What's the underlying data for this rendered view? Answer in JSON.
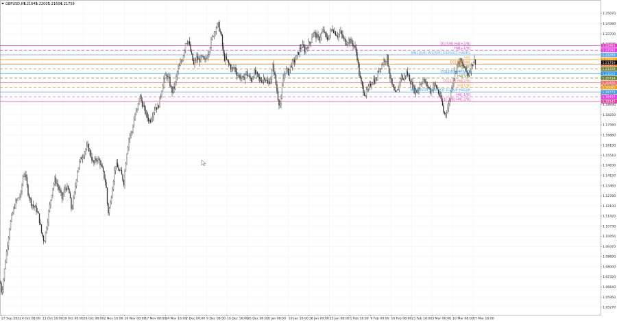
{
  "window": {
    "symbol_title": "GBPUSD,H4",
    "ohlc": [
      "1.21649",
      "1.22005",
      "1.21604",
      "1.21759"
    ]
  },
  "colors": {
    "background": "#ffffff",
    "candle": "#2f2f2f",
    "grid": "#eeeeee"
  },
  "chart_data": {
    "type": "line",
    "ylim": [
      1.0476,
      1.2593
    ],
    "yticks": [
      "1.25070",
      "1.24380",
      "1.23700",
      "1.23020",
      "1.22340",
      "1.21660",
      "1.20970",
      "1.20290",
      "1.19610",
      "1.18930",
      "1.18250",
      "1.17560",
      "1.16880",
      "1.16190",
      "1.15510",
      "1.14830",
      "1.14150",
      "1.13460",
      "1.12780",
      "1.12100",
      "1.11420",
      "1.10730",
      "1.10050",
      "1.09370",
      "1.08690",
      "1.08000",
      "1.07320",
      "1.06640",
      "1.05950",
      "1.05270"
    ],
    "xticks": [
      "27 Sep 2022",
      "4 Oct 08:00",
      "11 Oct 16:00",
      "19 Oct 00:00",
      "26 Oct 08:00",
      "2 Nov 16:00",
      "10 Nov 00:00",
      "17 Nov 08:00",
      "24 Nov 16:00",
      "2 Dec 00:00",
      "9 Dec 08:00",
      "16 Dec 16:00",
      "26 Dec 00:00",
      "3 Jan 08:00",
      "10 Jan 16:00",
      "18 Jan 00:00",
      "25 Jan 08:00",
      "1 Feb 16:00",
      "9 Feb 00:00",
      "16 Feb 08:00",
      "23 Feb 16:00",
      "3 Mar 00:00",
      "10 Mar 08:00",
      "17 Mar 16:00"
    ],
    "price_path": [
      [
        0,
        1.069
      ],
      [
        2,
        1.062
      ],
      [
        6,
        1.078
      ],
      [
        10,
        1.094
      ],
      [
        14,
        1.108
      ],
      [
        18,
        1.116
      ],
      [
        22,
        1.123
      ],
      [
        26,
        1.126
      ],
      [
        30,
        1.129
      ],
      [
        33,
        1.141
      ],
      [
        36,
        1.143
      ],
      [
        40,
        1.131
      ],
      [
        44,
        1.124
      ],
      [
        48,
        1.121
      ],
      [
        52,
        1.119
      ],
      [
        56,
        1.114
      ],
      [
        60,
        1.103
      ],
      [
        64,
        1.097
      ],
      [
        68,
        1.109
      ],
      [
        72,
        1.121
      ],
      [
        76,
        1.133
      ],
      [
        80,
        1.139
      ],
      [
        85,
        1.133
      ],
      [
        90,
        1.126
      ],
      [
        95,
        1.134
      ],
      [
        100,
        1.131
      ],
      [
        104,
        1.118
      ],
      [
        108,
        1.129
      ],
      [
        112,
        1.144
      ],
      [
        116,
        1.151
      ],
      [
        120,
        1.155
      ],
      [
        124,
        1.159
      ],
      [
        128,
        1.161
      ],
      [
        132,
        1.155
      ],
      [
        136,
        1.149
      ],
      [
        140,
        1.153
      ],
      [
        145,
        1.151
      ],
      [
        150,
        1.143
      ],
      [
        154,
        1.136
      ],
      [
        157,
        1.116
      ],
      [
        160,
        1.121
      ],
      [
        164,
        1.136
      ],
      [
        168,
        1.149
      ],
      [
        172,
        1.146
      ],
      [
        176,
        1.143
      ],
      [
        180,
        1.137
      ],
      [
        184,
        1.156
      ],
      [
        188,
        1.168
      ],
      [
        192,
        1.171
      ],
      [
        196,
        1.182
      ],
      [
        200,
        1.186
      ],
      [
        203,
        1.196
      ],
      [
        206,
        1.191
      ],
      [
        210,
        1.186
      ],
      [
        214,
        1.181
      ],
      [
        218,
        1.178
      ],
      [
        222,
        1.183
      ],
      [
        226,
        1.188
      ],
      [
        230,
        1.187
      ],
      [
        234,
        1.196
      ],
      [
        238,
        1.206
      ],
      [
        242,
        1.209
      ],
      [
        246,
        1.206
      ],
      [
        250,
        1.198
      ],
      [
        254,
        1.201
      ],
      [
        258,
        1.211
      ],
      [
        262,
        1.216
      ],
      [
        266,
        1.221
      ],
      [
        270,
        1.231
      ],
      [
        274,
        1.233
      ],
      [
        278,
        1.224
      ],
      [
        282,
        1.216
      ],
      [
        286,
        1.221
      ],
      [
        290,
        1.219
      ],
      [
        294,
        1.221
      ],
      [
        298,
        1.218
      ],
      [
        302,
        1.223
      ],
      [
        306,
        1.229
      ],
      [
        310,
        1.236
      ],
      [
        314,
        1.241
      ],
      [
        318,
        1.243
      ],
      [
        322,
        1.236
      ],
      [
        326,
        1.221
      ],
      [
        330,
        1.219
      ],
      [
        334,
        1.216
      ],
      [
        338,
        1.213
      ],
      [
        342,
        1.214
      ],
      [
        346,
        1.209
      ],
      [
        350,
        1.208
      ],
      [
        354,
        1.206
      ],
      [
        358,
        1.211
      ],
      [
        362,
        1.208
      ],
      [
        366,
        1.206
      ],
      [
        370,
        1.211
      ],
      [
        374,
        1.209
      ],
      [
        378,
        1.206
      ],
      [
        382,
        1.206
      ],
      [
        386,
        1.208
      ],
      [
        390,
        1.203
      ],
      [
        394,
        1.206
      ],
      [
        398,
        1.216
      ],
      [
        402,
        1.203
      ],
      [
        406,
        1.191
      ],
      [
        409,
        1.189
      ],
      [
        412,
        1.206
      ],
      [
        416,
        1.213
      ],
      [
        420,
        1.211
      ],
      [
        424,
        1.216
      ],
      [
        428,
        1.218
      ],
      [
        432,
        1.221
      ],
      [
        436,
        1.226
      ],
      [
        440,
        1.229
      ],
      [
        444,
        1.226
      ],
      [
        448,
        1.229
      ],
      [
        452,
        1.231
      ],
      [
        456,
        1.238
      ],
      [
        460,
        1.236
      ],
      [
        464,
        1.233
      ],
      [
        468,
        1.237
      ],
      [
        472,
        1.239
      ],
      [
        476,
        1.233
      ],
      [
        480,
        1.236
      ],
      [
        484,
        1.241
      ],
      [
        488,
        1.238
      ],
      [
        492,
        1.236
      ],
      [
        496,
        1.238
      ],
      [
        500,
        1.234
      ],
      [
        504,
        1.231
      ],
      [
        508,
        1.233
      ],
      [
        512,
        1.231
      ],
      [
        516,
        1.229
      ],
      [
        520,
        1.223
      ],
      [
        524,
        1.208
      ],
      [
        528,
        1.201
      ],
      [
        532,
        1.196
      ],
      [
        536,
        1.199
      ],
      [
        540,
        1.203
      ],
      [
        544,
        1.206
      ],
      [
        548,
        1.205
      ],
      [
        552,
        1.213
      ],
      [
        556,
        1.216
      ],
      [
        560,
        1.219
      ],
      [
        564,
        1.221
      ],
      [
        568,
        1.209
      ],
      [
        572,
        1.201
      ],
      [
        576,
        1.196
      ],
      [
        580,
        1.199
      ],
      [
        584,
        1.209
      ],
      [
        588,
        1.206
      ],
      [
        592,
        1.211
      ],
      [
        596,
        1.208
      ],
      [
        600,
        1.203
      ],
      [
        604,
        1.199
      ],
      [
        608,
        1.198
      ],
      [
        612,
        1.203
      ],
      [
        616,
        1.206
      ],
      [
        620,
        1.204
      ],
      [
        624,
        1.201
      ],
      [
        628,
        1.198
      ],
      [
        632,
        1.203
      ],
      [
        636,
        1.201
      ],
      [
        640,
        1.196
      ],
      [
        644,
        1.191
      ],
      [
        647,
        1.183
      ],
      [
        650,
        1.184
      ],
      [
        654,
        1.189
      ],
      [
        658,
        1.201
      ],
      [
        662,
        1.209
      ],
      [
        666,
        1.216
      ],
      [
        670,
        1.219
      ],
      [
        674,
        1.216
      ],
      [
        678,
        1.213
      ],
      [
        682,
        1.209
      ],
      [
        686,
        1.214
      ],
      [
        690,
        1.219
      ],
      [
        693,
        1.218
      ]
    ],
    "levels": [
      {
        "price": 1.22901,
        "label": "D1[5/8] H4[+2/8]",
        "color": "#e040c0",
        "style": "solid",
        "tag": "1.22901"
      },
      {
        "price": 1.22592,
        "label": "H4[+1/8]",
        "color": "#e040e0",
        "style": "dash",
        "tag": "1.22592"
      },
      {
        "price": 1.2228,
        "label": "MN1[5/8] W1[5/8] D1PIVOT H4RES",
        "color": "#5fa8e8",
        "style": "solid",
        "tag": "1.22280"
      },
      {
        "price": 1.21962,
        "label": "H4[",
        "color": "#f0a020",
        "style": "solid",
        "tag": "1.21962"
      },
      {
        "price": 1.2165,
        "label": "D1[3/8] H4[",
        "color": "#f07020",
        "style": "solid",
        "tag": "1.21650"
      },
      {
        "price": 1.21339,
        "label": "H4[5/8]",
        "color": "#708030",
        "style": "dash",
        "tag": "1.21339"
      },
      {
        "price": 1.21025,
        "label": "D1[2/8] H4PIVOT",
        "color": "#3090e0",
        "style": "solid",
        "tag": "1.21025"
      },
      {
        "price": 1.20714,
        "label": "H4[3/8]",
        "color": "#708030",
        "style": "dash",
        "tag": "1.20714"
      },
      {
        "price": 1.204,
        "label": "D1[1/8] H4[2/8]",
        "color": "#f07070",
        "style": "solid",
        "tag": "1.20400"
      },
      {
        "price": 1.20085,
        "label": "H4[1/8]",
        "color": "#f0a020",
        "style": "dash",
        "tag": "1.20085"
      },
      {
        "price": 1.19773,
        "label": "MN1PIVOT W1PIVOT D1SUP H4SUP",
        "color": "#40a0e0",
        "style": "solid",
        "tag": "1.19773"
      },
      {
        "price": 1.19457,
        "label": "H4[-1/8]",
        "color": "#e040e0",
        "style": "dash",
        "tag": "1.19457"
      },
      {
        "price": 1.19147,
        "label": "D1[-1/8] H4[-2/8]",
        "color": "#e040a0",
        "style": "solid",
        "tag": "1.19147"
      }
    ],
    "current_price": {
      "price": 1.21759,
      "tag": "1.21759",
      "color": "#000000"
    }
  }
}
